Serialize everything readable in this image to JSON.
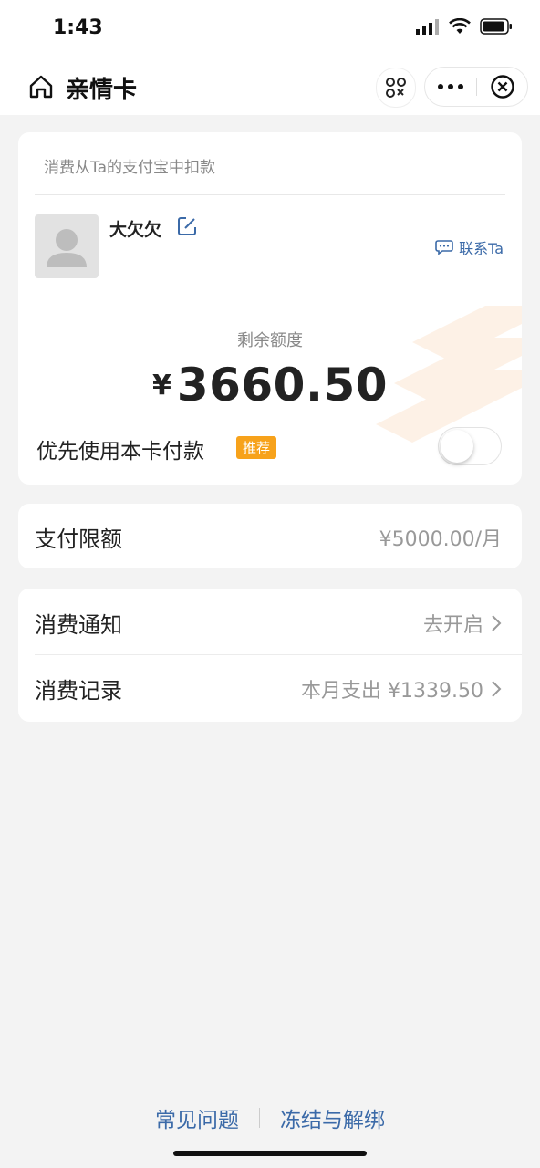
{
  "status_bar": {
    "time": "1:43"
  },
  "nav": {
    "title": "亲情卡"
  },
  "card": {
    "deduct_note": "消费从Ta的支付宝中扣款",
    "username": "大欠欠",
    "contact_label": "联系Ta",
    "remaining_label": "剩余额度",
    "currency": "¥",
    "remaining_amount": "3660.50",
    "prefer_label": "优先使用本卡付款",
    "recommend_badge": "推荐",
    "prefer_enabled": false
  },
  "limit": {
    "label": "支付限额",
    "value": "¥5000.00/月"
  },
  "notify": {
    "label": "消费通知",
    "value": "去开启"
  },
  "records": {
    "label": "消费记录",
    "value": "本月支出 ¥1339.50"
  },
  "footer": {
    "faq": "常见问题",
    "freeze": "冻结与解绑"
  },
  "colors": {
    "accent_blue": "#3b6aa8",
    "badge_orange": "#f7a21b",
    "background": "#f3f3f3"
  }
}
